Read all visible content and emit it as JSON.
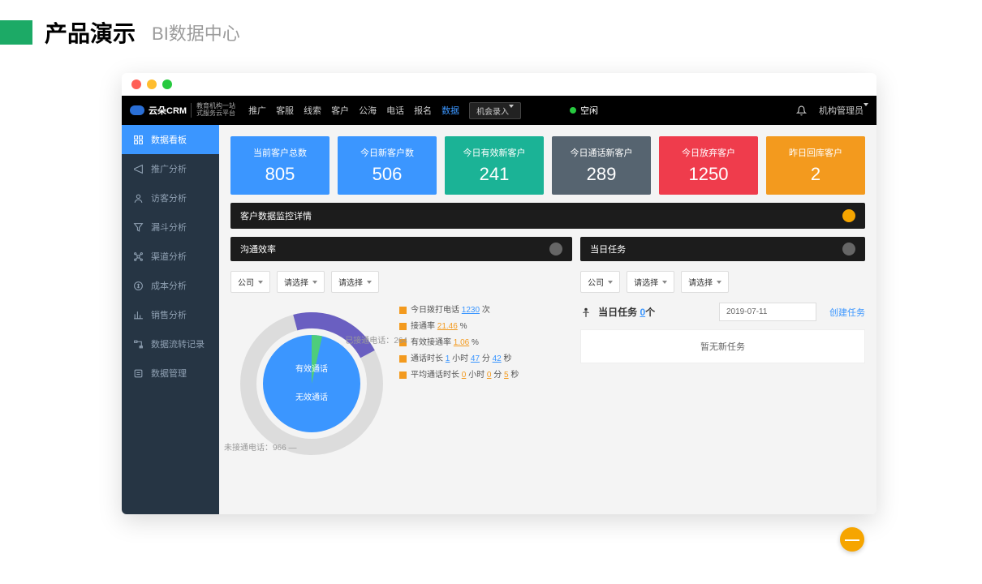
{
  "page_header": {
    "title": "产品演示",
    "subtitle": "BI数据中心"
  },
  "logo": {
    "brand": "云朵CRM",
    "sub1": "教育机构一站",
    "sub2": "式服务云平台"
  },
  "topnav": {
    "items": [
      "推广",
      "客服",
      "线索",
      "客户",
      "公海",
      "电话",
      "报名",
      "数据"
    ],
    "active_index": 7,
    "opportunity_btn": "机会录入",
    "idle_status": "空闲",
    "admin_label": "机构管理员"
  },
  "sidebar": {
    "items": [
      {
        "label": "数据看板",
        "icon": "dashboard"
      },
      {
        "label": "推广分析",
        "icon": "promo"
      },
      {
        "label": "访客分析",
        "icon": "visitor"
      },
      {
        "label": "漏斗分析",
        "icon": "funnel"
      },
      {
        "label": "渠道分析",
        "icon": "channel"
      },
      {
        "label": "成本分析",
        "icon": "cost"
      },
      {
        "label": "销售分析",
        "icon": "sales"
      },
      {
        "label": "数据流转记录",
        "icon": "flow"
      },
      {
        "label": "数据管理",
        "icon": "manage"
      }
    ],
    "active_index": 0
  },
  "stat_cards": [
    {
      "label": "当前客户总数",
      "value": "805",
      "cls": "c1"
    },
    {
      "label": "今日新客户数",
      "value": "506",
      "cls": "c2"
    },
    {
      "label": "今日有效新客户",
      "value": "241",
      "cls": "c3"
    },
    {
      "label": "今日通话新客户",
      "value": "289",
      "cls": "c4"
    },
    {
      "label": "今日放弃客户",
      "value": "1250",
      "cls": "c5"
    },
    {
      "label": "昨日回库客户",
      "value": "2",
      "cls": "c6"
    }
  ],
  "monitor_panel_title": "客户数据监控详情",
  "efficiency": {
    "title": "沟通效率",
    "filters": {
      "company": "公司",
      "select1": "请选择",
      "select2": "请选择"
    },
    "metrics": {
      "dial_prefix": "今日拨打电话",
      "dial_val": "1230",
      "dial_suffix": "次",
      "conn_prefix": "接通率",
      "conn_val": "21.46",
      "conn_suffix": "%",
      "eff_prefix": "有效接通率",
      "eff_val": "1.06",
      "eff_suffix": "%",
      "dur_prefix": "通话时长",
      "dur_h": "1",
      "dur_m": "47",
      "dur_s": "42",
      "h": "小时",
      "m": "分",
      "s": "秒",
      "avg_prefix": "平均通话时长",
      "avg_h": "0",
      "avg_m": "0",
      "avg_s": "5"
    },
    "donut": {
      "connected_label": "已接通电话：",
      "connected_val": "264",
      "missed_label": "未接通电话：",
      "missed_val": "966",
      "inner_top": "有效通话",
      "inner_bot": "无效通话"
    }
  },
  "tasks": {
    "title": "当日任务",
    "filters": {
      "company": "公司",
      "select1": "请选择",
      "select2": "请选择"
    },
    "label_prefix": "当日任务",
    "count": "0",
    "label_suffix": "个",
    "date": "2019-07-11",
    "create_link": "创建任务",
    "empty": "暂无新任务"
  },
  "chart_data": {
    "type": "pie",
    "title": "沟通效率",
    "series": [
      {
        "name": "outer_ring",
        "slices": [
          {
            "name": "未接通电话",
            "value": 966,
            "color": "#dcdcdc"
          },
          {
            "name": "已接通电话",
            "value": 264,
            "color": "#6a5fc1"
          }
        ]
      },
      {
        "name": "inner_ring",
        "slices": [
          {
            "name": "无效通话",
            "value": 251,
            "color": "#3b96ff"
          },
          {
            "name": "有效通话",
            "value": 13,
            "color": "#4ecd7b"
          }
        ]
      }
    ],
    "metrics": {
      "total_dials": 1230,
      "connect_rate_pct": 21.46,
      "effective_connect_rate_pct": 1.06,
      "duration": {
        "h": 1,
        "m": 47,
        "s": 42
      },
      "avg_duration": {
        "h": 0,
        "m": 0,
        "s": 5
      }
    }
  }
}
